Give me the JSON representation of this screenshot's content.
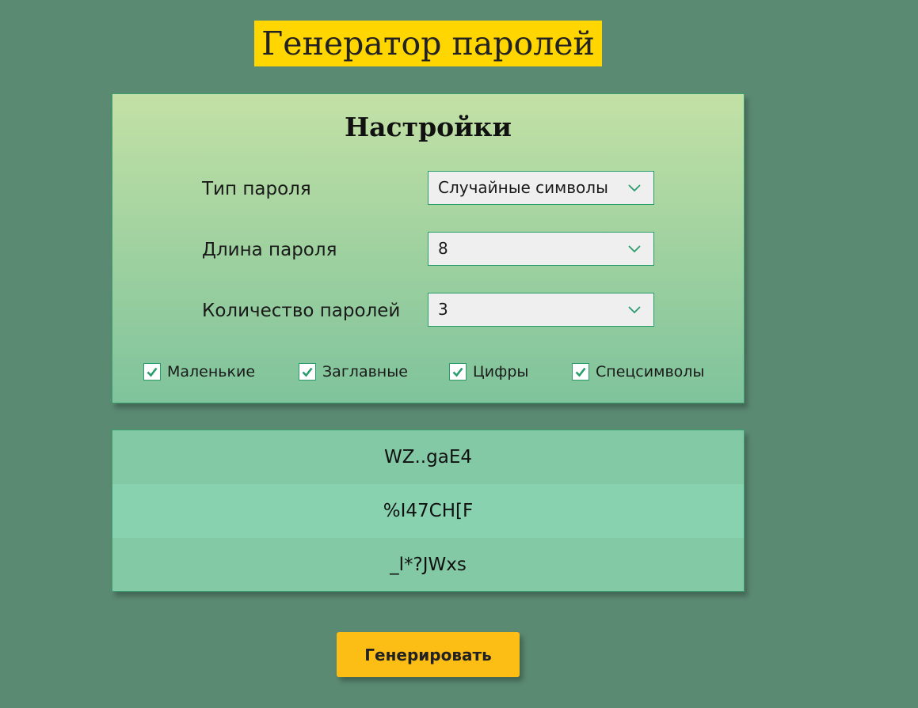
{
  "page": {
    "title": "Генератор паролей"
  },
  "settings": {
    "title": "Настройки",
    "password_type": {
      "label": "Тип пароля",
      "value": "Случайные символы"
    },
    "password_length": {
      "label": "Длина пароля",
      "value": "8"
    },
    "password_count": {
      "label": "Количество паролей",
      "value": "3"
    },
    "checkboxes": [
      {
        "label": "Маленькие",
        "checked": true
      },
      {
        "label": "Заглавные",
        "checked": true
      },
      {
        "label": "Цифры",
        "checked": true
      },
      {
        "label": "Спецсимволы",
        "checked": true
      }
    ]
  },
  "results": {
    "passwords": [
      "WZ..gaE4",
      "%I47CH[F",
      "_l*?JWxs"
    ]
  },
  "actions": {
    "generate_label": "Генерировать"
  },
  "colors": {
    "background": "#5b8a73",
    "title_bg": "#ffd600",
    "accent": "#2a9c6c",
    "button": "#fcbd14"
  },
  "icons": {
    "select_arrow": "chevron-down-icon",
    "checkbox_mark": "checkmark-icon"
  }
}
